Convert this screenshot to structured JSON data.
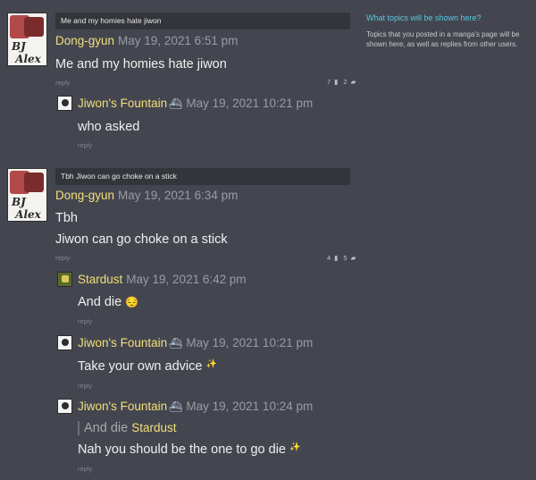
{
  "sidebar": {
    "title": "What topics will be shown here?",
    "text": "Topics that you posted in a manga's page will be shown here, as well as replies from other users."
  },
  "threads": [
    {
      "title": "Me and my homies hate jiwon",
      "author": "Dong-gyun",
      "date": "May 19, 2021 6:51 pm",
      "body": "Me and my homies hate jiwon",
      "reply": "reply",
      "upvotes": "7",
      "replies_count": "2",
      "comments": [
        {
          "author": "Jiwon's Fountain",
          "date": "May 19, 2021 10:21 pm",
          "body": "who asked",
          "reply": "reply"
        }
      ]
    },
    {
      "title": "Tbh Jiwon can go choke on a stick",
      "author": "Dong-gyun",
      "date": "May 19, 2021 6:34 pm",
      "body_line1": "Tbh",
      "body_line2": "Jiwon can go choke on a stick",
      "reply": "reply",
      "upvotes": "4",
      "replies_count": "5",
      "comments": [
        {
          "author": "Stardust",
          "date": "May 19, 2021 6:42 pm",
          "body": "And die",
          "reply": "reply"
        },
        {
          "author": "Jiwon's Fountain",
          "date": "May 19, 2021 10:21 pm",
          "body": "Take your own advice",
          "reply": "reply"
        },
        {
          "author": "Jiwon's Fountain",
          "date": "May 19, 2021 10:24 pm",
          "quote_text": "And die",
          "quote_author": "Stardust",
          "body": "Nah you should be the one to go die",
          "reply": "reply"
        }
      ]
    }
  ]
}
